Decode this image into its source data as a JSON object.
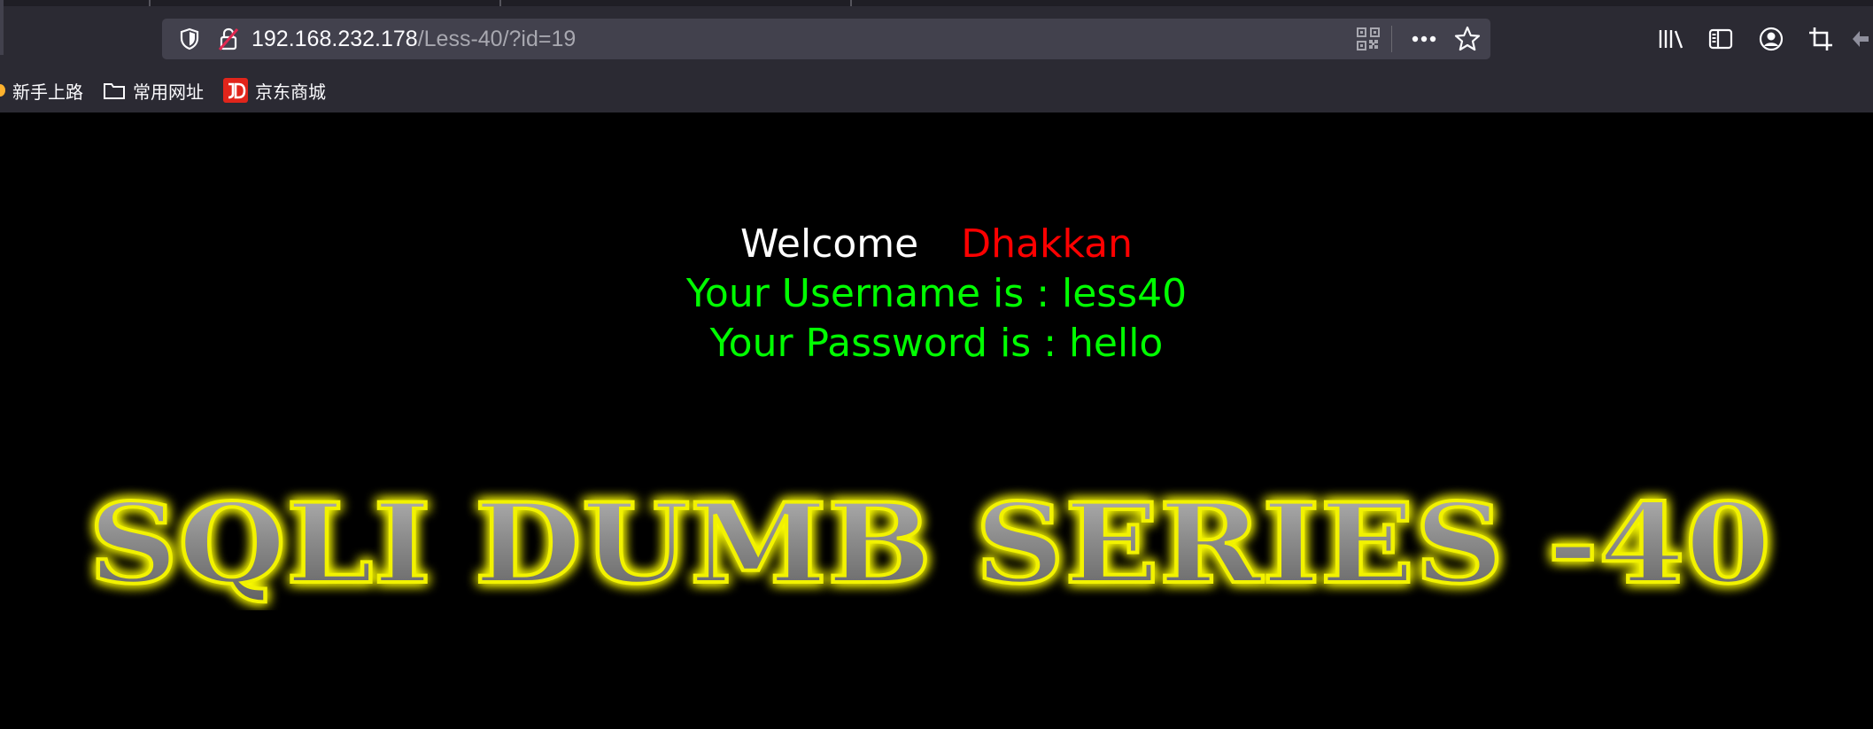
{
  "browser": {
    "url_host": "192.168.232.178",
    "url_path": "/Less-40/?id=19",
    "icons": {
      "tracking_protection": "shield-icon",
      "insecure_connection": "lock-strike-icon",
      "qr_code": "qr-code-icon",
      "page_actions": "more-horizontal-icon",
      "bookmark_star": "star-icon",
      "library": "library-icon",
      "sidebar": "sidebar-icon",
      "account": "account-icon",
      "screenshot": "crop-icon"
    }
  },
  "bookmarks": [
    {
      "label": "新手上路",
      "icon": "firefox-dot-icon"
    },
    {
      "label": "常用网址",
      "icon": "folder-icon"
    },
    {
      "label": "京东商城",
      "icon": "jd-logo-icon"
    }
  ],
  "page": {
    "welcome_word": "Welcome",
    "welcome_name": "Dhakkan",
    "username_line": "Your Username is : less40",
    "password_line": "Your Password is : hello",
    "banner_text": "SQLI DUMB SERIES -40"
  },
  "colors": {
    "welcome_word": "#ffffff",
    "welcome_name": "#ff0000",
    "credentials": "#00ff00",
    "banner_fill": "#8a8a8a",
    "banner_glow": "#ffff00"
  }
}
